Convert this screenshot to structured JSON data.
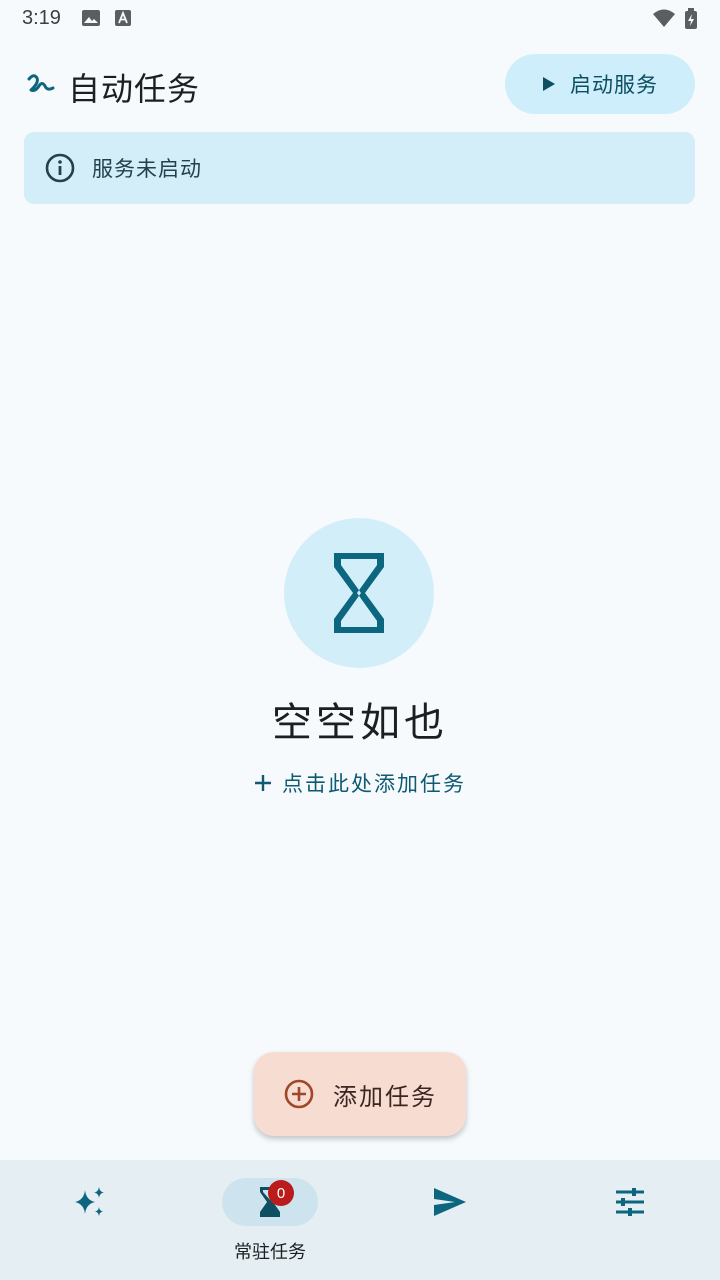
{
  "status_bar": {
    "time": "3:19"
  },
  "header": {
    "title": "自动任务",
    "start_button_label": "启动服务"
  },
  "banner": {
    "text": "服务未启动"
  },
  "empty_state": {
    "title": "空空如也",
    "add_link": "点击此处添加任务"
  },
  "fab": {
    "label": "添加任务"
  },
  "bottom_nav": {
    "items": [
      {
        "icon": "sparkles-icon",
        "label": ""
      },
      {
        "icon": "hourglass-icon",
        "label": "常驻任务",
        "badge": "0",
        "active": true
      },
      {
        "icon": "send-icon",
        "label": ""
      },
      {
        "icon": "tune-icon",
        "label": ""
      }
    ]
  },
  "colors": {
    "primary": "#0d6680",
    "container": "#cdeefa",
    "fab": "#f7dcd2",
    "fab_icon": "#a0472a",
    "badge": "#ba1b1b"
  }
}
